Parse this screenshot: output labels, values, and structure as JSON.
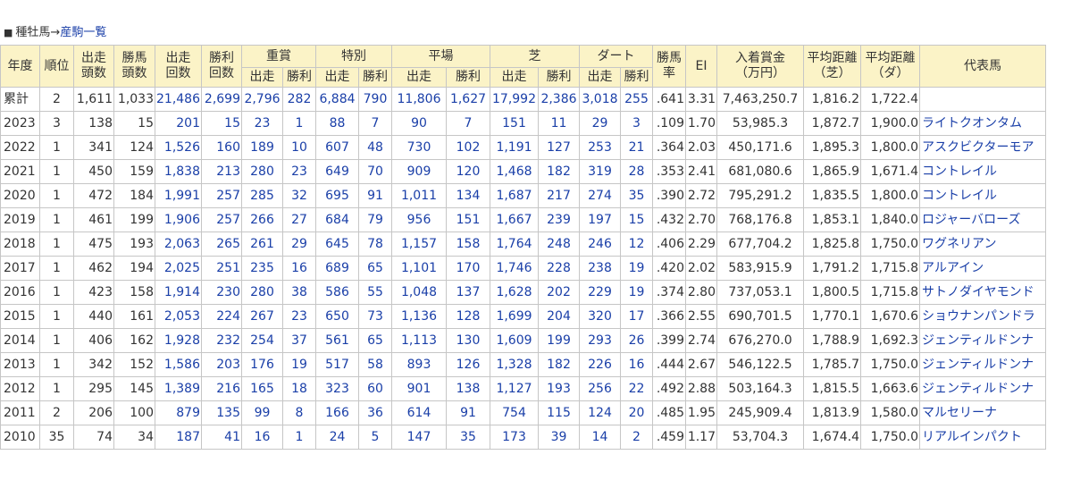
{
  "heading": {
    "square": "■",
    "label": "種牡馬",
    "arrow": "→",
    "link": "産駒一覧"
  },
  "headers": {
    "year": "年度",
    "rank": "順位",
    "starters_heads": "出走\n頭数",
    "winners_heads": "勝馬\n頭数",
    "starts": "出走\n回数",
    "wins": "勝利\n回数",
    "graded": "重賞",
    "special": "特別",
    "flat": "平場",
    "turf": "芝",
    "dirt": "ダート",
    "win_rate": "勝馬\n率",
    "ei": "EI",
    "prize": "入着賞金\n（万円）",
    "avg_dist_turf": "平均距離\n（芝）",
    "avg_dist_dirt": "平均距離\n（ダ）",
    "rep_horse": "代表馬",
    "sub_start": "出走",
    "sub_win": "勝利"
  },
  "rows": [
    {
      "year": "累計",
      "rank": "2",
      "heads": "1,611",
      "win_heads": "1,033",
      "starts": "21,486",
      "wins": "2,699",
      "g_s": "2,796",
      "g_w": "282",
      "sp_s": "6,884",
      "sp_w": "790",
      "fl_s": "11,806",
      "fl_w": "1,627",
      "tf_s": "17,992",
      "tf_w": "2,386",
      "dt_s": "3,018",
      "dt_w": "255",
      "rate": ".641",
      "ei": "3.31",
      "prize": "7,463,250.7",
      "d_turf": "1,816.2",
      "d_dirt": "1,722.4",
      "horse": ""
    },
    {
      "year": "2023",
      "rank": "3",
      "heads": "138",
      "win_heads": "15",
      "starts": "201",
      "wins": "15",
      "g_s": "23",
      "g_w": "1",
      "sp_s": "88",
      "sp_w": "7",
      "fl_s": "90",
      "fl_w": "7",
      "tf_s": "151",
      "tf_w": "11",
      "dt_s": "29",
      "dt_w": "3",
      "rate": ".109",
      "ei": "1.70",
      "prize": "53,985.3",
      "d_turf": "1,872.7",
      "d_dirt": "1,900.0",
      "horse": "ライトクオンタム"
    },
    {
      "year": "2022",
      "rank": "1",
      "heads": "341",
      "win_heads": "124",
      "starts": "1,526",
      "wins": "160",
      "g_s": "189",
      "g_w": "10",
      "sp_s": "607",
      "sp_w": "48",
      "fl_s": "730",
      "fl_w": "102",
      "tf_s": "1,191",
      "tf_w": "127",
      "dt_s": "253",
      "dt_w": "21",
      "rate": ".364",
      "ei": "2.03",
      "prize": "450,171.6",
      "d_turf": "1,895.3",
      "d_dirt": "1,800.0",
      "horse": "アスクビクターモア"
    },
    {
      "year": "2021",
      "rank": "1",
      "heads": "450",
      "win_heads": "159",
      "starts": "1,838",
      "wins": "213",
      "g_s": "280",
      "g_w": "23",
      "sp_s": "649",
      "sp_w": "70",
      "fl_s": "909",
      "fl_w": "120",
      "tf_s": "1,468",
      "tf_w": "182",
      "dt_s": "319",
      "dt_w": "28",
      "rate": ".353",
      "ei": "2.41",
      "prize": "681,080.6",
      "d_turf": "1,865.9",
      "d_dirt": "1,671.4",
      "horse": "コントレイル"
    },
    {
      "year": "2020",
      "rank": "1",
      "heads": "472",
      "win_heads": "184",
      "starts": "1,991",
      "wins": "257",
      "g_s": "285",
      "g_w": "32",
      "sp_s": "695",
      "sp_w": "91",
      "fl_s": "1,011",
      "fl_w": "134",
      "tf_s": "1,687",
      "tf_w": "217",
      "dt_s": "274",
      "dt_w": "35",
      "rate": ".390",
      "ei": "2.72",
      "prize": "795,291.2",
      "d_turf": "1,835.5",
      "d_dirt": "1,800.0",
      "horse": "コントレイル"
    },
    {
      "year": "2019",
      "rank": "1",
      "heads": "461",
      "win_heads": "199",
      "starts": "1,906",
      "wins": "257",
      "g_s": "266",
      "g_w": "27",
      "sp_s": "684",
      "sp_w": "79",
      "fl_s": "956",
      "fl_w": "151",
      "tf_s": "1,667",
      "tf_w": "239",
      "dt_s": "197",
      "dt_w": "15",
      "rate": ".432",
      "ei": "2.70",
      "prize": "768,176.8",
      "d_turf": "1,853.1",
      "d_dirt": "1,840.0",
      "horse": "ロジャーバローズ"
    },
    {
      "year": "2018",
      "rank": "1",
      "heads": "475",
      "win_heads": "193",
      "starts": "2,063",
      "wins": "265",
      "g_s": "261",
      "g_w": "29",
      "sp_s": "645",
      "sp_w": "78",
      "fl_s": "1,157",
      "fl_w": "158",
      "tf_s": "1,764",
      "tf_w": "248",
      "dt_s": "246",
      "dt_w": "12",
      "rate": ".406",
      "ei": "2.29",
      "prize": "677,704.2",
      "d_turf": "1,825.8",
      "d_dirt": "1,750.0",
      "horse": "ワグネリアン"
    },
    {
      "year": "2017",
      "rank": "1",
      "heads": "462",
      "win_heads": "194",
      "starts": "2,025",
      "wins": "251",
      "g_s": "235",
      "g_w": "16",
      "sp_s": "689",
      "sp_w": "65",
      "fl_s": "1,101",
      "fl_w": "170",
      "tf_s": "1,746",
      "tf_w": "228",
      "dt_s": "238",
      "dt_w": "19",
      "rate": ".420",
      "ei": "2.02",
      "prize": "583,915.9",
      "d_turf": "1,791.2",
      "d_dirt": "1,715.8",
      "horse": "アルアイン"
    },
    {
      "year": "2016",
      "rank": "1",
      "heads": "423",
      "win_heads": "158",
      "starts": "1,914",
      "wins": "230",
      "g_s": "280",
      "g_w": "38",
      "sp_s": "586",
      "sp_w": "55",
      "fl_s": "1,048",
      "fl_w": "137",
      "tf_s": "1,628",
      "tf_w": "202",
      "dt_s": "229",
      "dt_w": "19",
      "rate": ".374",
      "ei": "2.80",
      "prize": "737,053.1",
      "d_turf": "1,800.5",
      "d_dirt": "1,715.8",
      "horse": "サトノダイヤモンド"
    },
    {
      "year": "2015",
      "rank": "1",
      "heads": "440",
      "win_heads": "161",
      "starts": "2,053",
      "wins": "224",
      "g_s": "267",
      "g_w": "23",
      "sp_s": "650",
      "sp_w": "73",
      "fl_s": "1,136",
      "fl_w": "128",
      "tf_s": "1,699",
      "tf_w": "204",
      "dt_s": "320",
      "dt_w": "17",
      "rate": ".366",
      "ei": "2.55",
      "prize": "690,701.5",
      "d_turf": "1,770.1",
      "d_dirt": "1,670.6",
      "horse": "ショウナンパンドラ"
    },
    {
      "year": "2014",
      "rank": "1",
      "heads": "406",
      "win_heads": "162",
      "starts": "1,928",
      "wins": "232",
      "g_s": "254",
      "g_w": "37",
      "sp_s": "561",
      "sp_w": "65",
      "fl_s": "1,113",
      "fl_w": "130",
      "tf_s": "1,609",
      "tf_w": "199",
      "dt_s": "293",
      "dt_w": "26",
      "rate": ".399",
      "ei": "2.74",
      "prize": "676,270.0",
      "d_turf": "1,788.9",
      "d_dirt": "1,692.3",
      "horse": "ジェンティルドンナ"
    },
    {
      "year": "2013",
      "rank": "1",
      "heads": "342",
      "win_heads": "152",
      "starts": "1,586",
      "wins": "203",
      "g_s": "176",
      "g_w": "19",
      "sp_s": "517",
      "sp_w": "58",
      "fl_s": "893",
      "fl_w": "126",
      "tf_s": "1,328",
      "tf_w": "182",
      "dt_s": "226",
      "dt_w": "16",
      "rate": ".444",
      "ei": "2.67",
      "prize": "546,122.5",
      "d_turf": "1,785.7",
      "d_dirt": "1,750.0",
      "horse": "ジェンティルドンナ"
    },
    {
      "year": "2012",
      "rank": "1",
      "heads": "295",
      "win_heads": "145",
      "starts": "1,389",
      "wins": "216",
      "g_s": "165",
      "g_w": "18",
      "sp_s": "323",
      "sp_w": "60",
      "fl_s": "901",
      "fl_w": "138",
      "tf_s": "1,127",
      "tf_w": "193",
      "dt_s": "256",
      "dt_w": "22",
      "rate": ".492",
      "ei": "2.88",
      "prize": "503,164.3",
      "d_turf": "1,815.5",
      "d_dirt": "1,663.6",
      "horse": "ジェンティルドンナ"
    },
    {
      "year": "2011",
      "rank": "2",
      "heads": "206",
      "win_heads": "100",
      "starts": "879",
      "wins": "135",
      "g_s": "99",
      "g_w": "8",
      "sp_s": "166",
      "sp_w": "36",
      "fl_s": "614",
      "fl_w": "91",
      "tf_s": "754",
      "tf_w": "115",
      "dt_s": "124",
      "dt_w": "20",
      "rate": ".485",
      "ei": "1.95",
      "prize": "245,909.4",
      "d_turf": "1,813.9",
      "d_dirt": "1,580.0",
      "horse": "マルセリーナ"
    },
    {
      "year": "2010",
      "rank": "35",
      "heads": "74",
      "win_heads": "34",
      "starts": "187",
      "wins": "41",
      "g_s": "16",
      "g_w": "1",
      "sp_s": "24",
      "sp_w": "5",
      "fl_s": "147",
      "fl_w": "35",
      "tf_s": "173",
      "tf_w": "39",
      "dt_s": "14",
      "dt_w": "2",
      "rate": ".459",
      "ei": "1.17",
      "prize": "53,704.3",
      "d_turf": "1,674.4",
      "d_dirt": "1,750.0",
      "horse": "リアルインパクト"
    }
  ]
}
